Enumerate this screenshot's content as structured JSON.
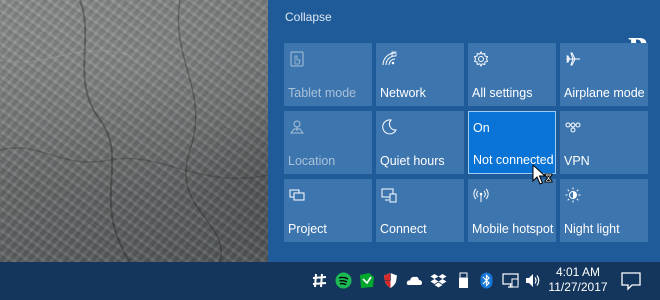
{
  "action_center": {
    "collapse_label": "Collapse",
    "logo_text": "gP",
    "tiles": [
      {
        "label": "Tablet mode",
        "icon": "tablet-mode-icon",
        "state": "disabled"
      },
      {
        "label": "Network",
        "icon": "network-icon",
        "state": "normal"
      },
      {
        "label": "All settings",
        "icon": "gear-icon",
        "state": "normal"
      },
      {
        "label": "Airplane mode",
        "icon": "airplane-icon",
        "state": "normal"
      },
      {
        "label": "Location",
        "icon": "location-icon",
        "state": "disabled"
      },
      {
        "label": "Quiet hours",
        "icon": "moon-icon",
        "state": "normal"
      },
      {
        "label": "Not connected",
        "top_label": "On",
        "icon": "",
        "state": "active"
      },
      {
        "label": "VPN",
        "icon": "vpn-icon",
        "state": "normal"
      },
      {
        "label": "Project",
        "icon": "project-icon",
        "state": "normal"
      },
      {
        "label": "Connect",
        "icon": "connect-icon",
        "state": "normal"
      },
      {
        "label": "Mobile hotspot",
        "icon": "hotspot-icon",
        "state": "normal"
      },
      {
        "label": "Night light",
        "icon": "brightness-icon",
        "state": "normal"
      }
    ]
  },
  "taskbar": {
    "tray_icons": [
      "slack-icon",
      "spotify-icon",
      "evernote-icon",
      "shield-icon",
      "onedrive-icon",
      "dropbox-icon",
      "usb-drive-icon",
      "bluetooth-icon",
      "network-monitor-icon",
      "volume-icon"
    ],
    "time": "4:01 AM",
    "date": "11/27/2017",
    "notification_icon": "notification-icon"
  },
  "colors": {
    "panel": "#1f5b98",
    "tile": "#3d75ae",
    "tile_active": "#0a74d6",
    "taskbar": "#14365c"
  }
}
